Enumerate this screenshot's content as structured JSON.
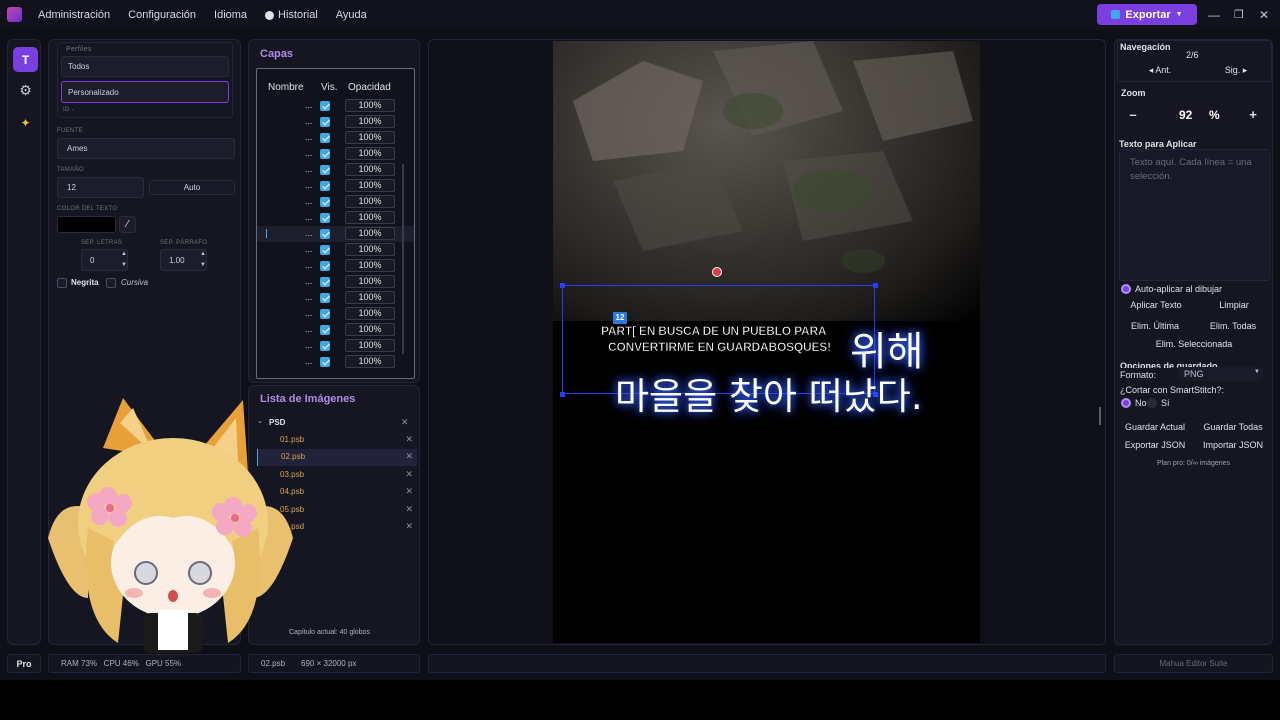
{
  "menu": {
    "items": [
      "Administración",
      "Configuración",
      "Idioma",
      "Historial",
      "Ayuda"
    ],
    "export_label": "Exportar"
  },
  "left": {
    "perfiles_label": "Perfiles",
    "profile_all": "Todos",
    "profile_custom": "Personalizado",
    "id_label": "ID -",
    "fuente_label": "FUENTE",
    "font_value": "Ames",
    "tamano_label": "TAMAÑO",
    "size_value": "12",
    "auto_label": "Auto",
    "color_label": "COLOR DEL TEXTO",
    "sep_letras_label": "SEP. LETRAS",
    "sep_letras_value": "0",
    "sep_parrafo_label": "SEP. PÁRRAFO",
    "sep_parrafo_value": "1.00",
    "bold_label": "Negrita",
    "italic_label": "Cursiva"
  },
  "layers": {
    "title": "Capas",
    "col_name": "Nombre",
    "col_vis": "Vis.",
    "col_opacity": "Opacidad",
    "rows": [
      "...",
      "...",
      "...",
      "...",
      "...",
      "...",
      "...",
      "...",
      "...",
      "...",
      "...",
      "...",
      "...",
      "...",
      "...",
      "...",
      "..."
    ],
    "opacity_values": [
      "100%",
      "100%",
      "100%",
      "100%",
      "100%",
      "100%",
      "100%",
      "100%",
      "100%",
      "100%",
      "100%",
      "100%",
      "100%",
      "100%",
      "100%",
      "100%",
      "100%"
    ]
  },
  "images": {
    "title": "Lista de Imágenes",
    "folder": "PSD",
    "files": [
      "01.psb",
      "02.psb",
      "03.psb",
      "04.psb",
      "05.psb",
      "06.psd"
    ],
    "chapter_info": "Capítulo actual: 40 globos"
  },
  "canvas": {
    "marker": "12",
    "translation_line1": "PART[ EN BUSCA DE UN PUEBLO PARA",
    "translation_line2": "CONVERTIRME EN GUARDABOSQUES!",
    "korean_line1": "위해",
    "korean_line2": "마을을 찾아 떠났다."
  },
  "right": {
    "nav_title": "Navegación",
    "page": "2/6",
    "prev": "◂ Ant.",
    "next": "Sig. ▸",
    "zoom_title": "Zoom",
    "zoom_minus": "–",
    "zoom_value": "92",
    "zoom_unit": "%",
    "zoom_plus": "+",
    "text_title": "Texto para Aplicar",
    "text_placeholder": "Texto aquí. Cada línea = una selección.",
    "auto_apply": "Auto-aplicar al dibujar",
    "apply_text": "Aplicar Texto",
    "clear": "Limpiar",
    "del_last": "Elim. Última",
    "del_all": "Elim. Todas",
    "del_sel": "Elim. Seleccionada",
    "save_title": "Opciones de guardado",
    "format_label": "Formato:",
    "format_value": "PNG",
    "smartstitch": "¿Cortar con SmartStitch?:",
    "no": "No",
    "si": "Sí",
    "save_current": "Guardar Actual",
    "save_all": "Guardar Todas",
    "export_json": "Exportar JSON",
    "import_json": "Importar JSON",
    "plan": "Plan pro: 0/∞ imágenes"
  },
  "status": {
    "pro": "Pro",
    "stats": "RAM 73%   CPU 46%   GPU 55%",
    "file": "02.psb",
    "dims": "690 × 32000 px",
    "suite": "Mahua Editor Suite"
  },
  "colors": {
    "accent": "#7b3fe0",
    "check": "#3fa9e8",
    "file_orange": "#d9a24a",
    "selection": "#2a3aff"
  }
}
